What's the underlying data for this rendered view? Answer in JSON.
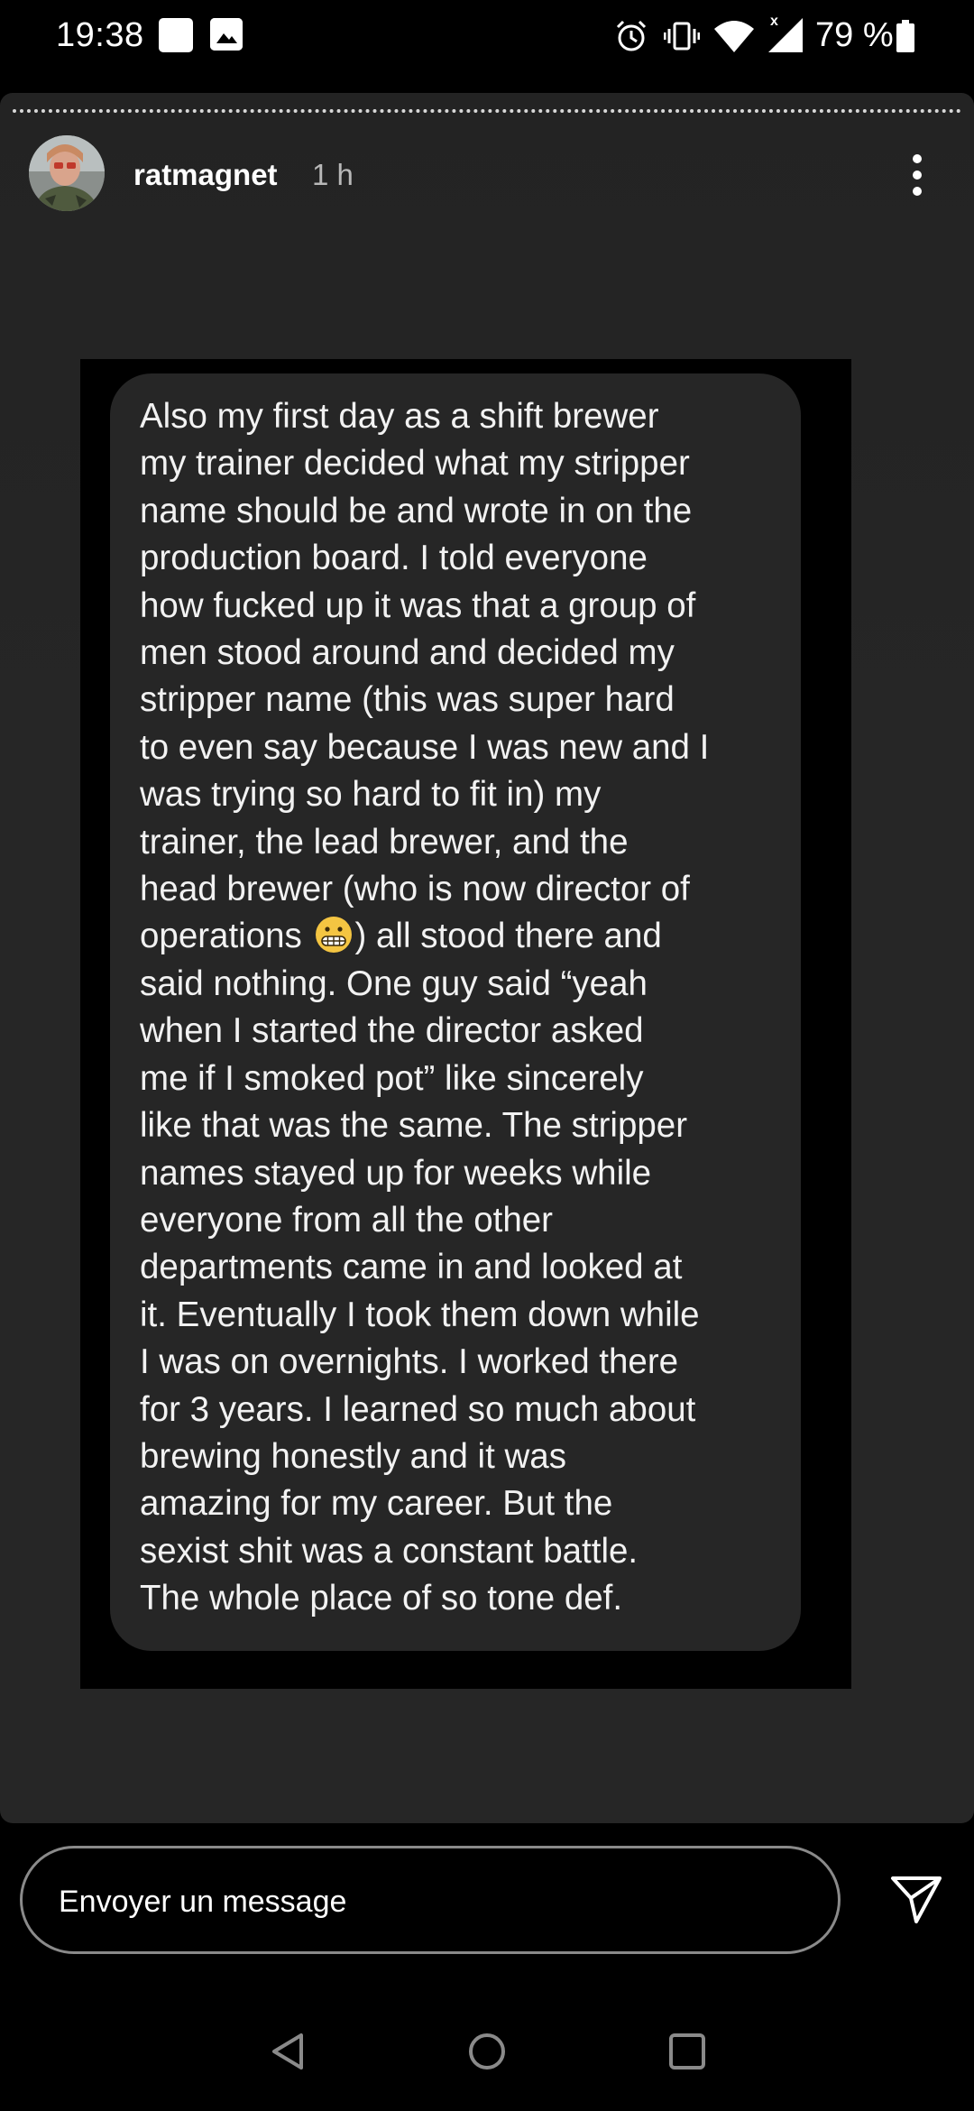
{
  "status_bar": {
    "time": "19:38",
    "battery": "79 %",
    "icons": [
      "notification-square-icon",
      "image-icon",
      "alarm-icon",
      "vibrate-icon",
      "wifi-icon",
      "signal-icon",
      "battery-icon"
    ]
  },
  "story": {
    "username": "ratmagnet",
    "time_ago": "1 h",
    "message_lines": [
      "Also my first day as a shift brewer",
      "my trainer decided what my stripper",
      "name should be and wrote in on the",
      "production board. I told everyone",
      "how fucked up it was that a group of",
      "men stood around and decided my",
      "stripper name (this was super hard",
      "to even say because I was new and I",
      "was trying so hard to fit in) my",
      "trainer, the lead brewer, and the",
      "head brewer (who is now director of",
      "operations",
      ") all stood there and",
      "said nothing. One guy said “yeah",
      "when I started the director asked",
      "me if I smoked pot” like sincerely",
      "like that was the same. The stripper",
      "names stayed up for weeks while",
      "everyone from all the other",
      "departments came in and looked at",
      "it. Eventually I took them down while",
      "I was on overnights. I worked there",
      "for 3 years. I learned so much about",
      "brewing honestly and it was",
      "amazing for my career. But the",
      "sexist shit was a constant battle.",
      "The whole place of so tone def."
    ]
  },
  "reply": {
    "placeholder": "Envoyer un message"
  },
  "colors": {
    "background": "#000000",
    "panel": "#262626",
    "bubble": "#262626",
    "text": "#f2f2f2",
    "muted": "#b8b8b8"
  }
}
